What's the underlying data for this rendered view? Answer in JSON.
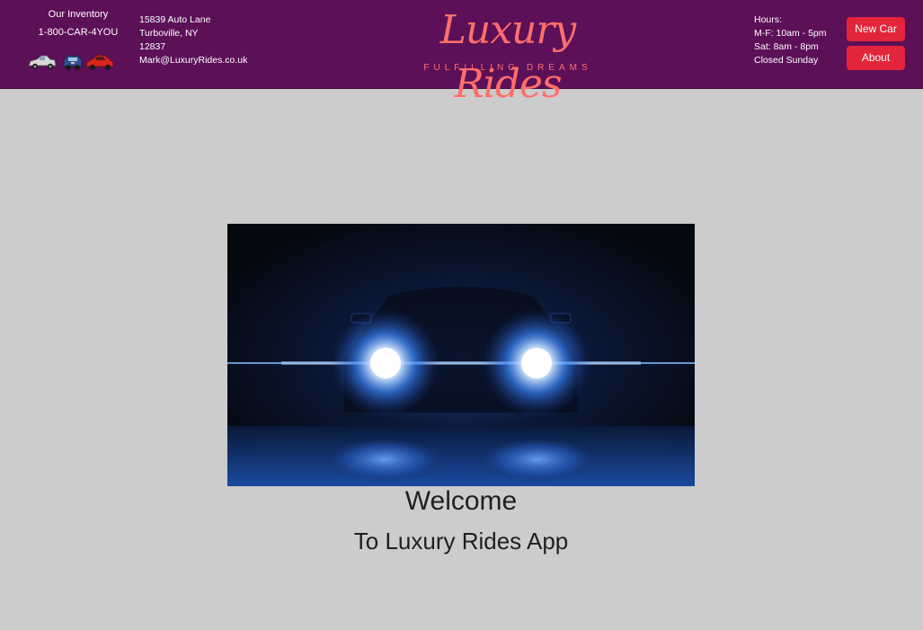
{
  "header": {
    "inventory": {
      "title": "Our Inventory",
      "phone": "1-800-CAR-4YOU",
      "car_icons": [
        "silver-convertible-icon",
        "blue-vintage-car-icon",
        "red-sports-car-icon"
      ]
    },
    "address": {
      "street": "15839 Auto Lane",
      "city_state": "Turboville, NY",
      "zip": "12837",
      "email": "Mark@LuxuryRides.co.uk"
    },
    "logo": {
      "name": "Luxury Rides",
      "tagline": "FULFILLING DREAMS"
    },
    "hours": {
      "label": "Hours:",
      "weekdays": "M-F: 10am - 5pm",
      "saturday": "Sat: 8am - 8pm",
      "sunday": "Closed Sunday"
    },
    "nav": {
      "new_car_label": "New Car",
      "about_label": "About"
    }
  },
  "main": {
    "hero_image": "car-headlights-image",
    "welcome": "Welcome",
    "subtitle": "To Luxury Rides App"
  },
  "colors": {
    "header_bg": "#5c1058",
    "page_bg": "#cccccc",
    "logo": "#ff6f6a",
    "button": "#e2253a"
  }
}
